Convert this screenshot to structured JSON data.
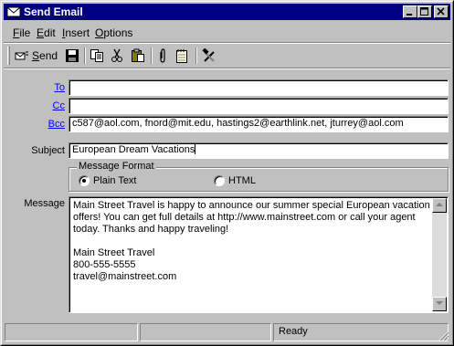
{
  "window": {
    "title": "Send Email"
  },
  "menu": [
    {
      "key": "F",
      "rest": "ile"
    },
    {
      "key": "E",
      "rest": "dit"
    },
    {
      "key": "I",
      "rest": "nsert"
    },
    {
      "key": "O",
      "rest": "ptions"
    }
  ],
  "toolbar": {
    "send_key": "S",
    "send_rest": "end",
    "icons": [
      "send-icon",
      "save-icon",
      "copy-icon",
      "cut-icon",
      "paste-icon",
      "attach-icon",
      "notepad-icon",
      "tools-icon"
    ]
  },
  "form": {
    "to_label": "To",
    "to_value": "",
    "cc_label": "Cc",
    "cc_value": "",
    "bcc_label": "Bcc",
    "bcc_value": "c587@aol.com, fnord@mit.edu, hastings2@earthlink.net, jturrey@aol.com",
    "subject_label": "Subject",
    "subject_value": "European Dream Vacations",
    "format_legend": "Message Format",
    "format_options": [
      "Plain Text",
      "HTML"
    ],
    "format_selected": "Plain Text",
    "message_label": "Message",
    "message_value": "Main Street Travel is happy to announce our summer special European vacation\noffers! You can get full details at http://www.mainstreet.com or call your agent\ntoday. Thanks and happy traveling!\n\nMain Street Travel\n800-555-5555\ntravel@mainstreet.com"
  },
  "status": {
    "panel1": "",
    "panel2": "",
    "panel3": "Ready"
  },
  "colors": {
    "title_bar": "#000080",
    "face": "#c0c0c0",
    "link": "#0000ee"
  }
}
